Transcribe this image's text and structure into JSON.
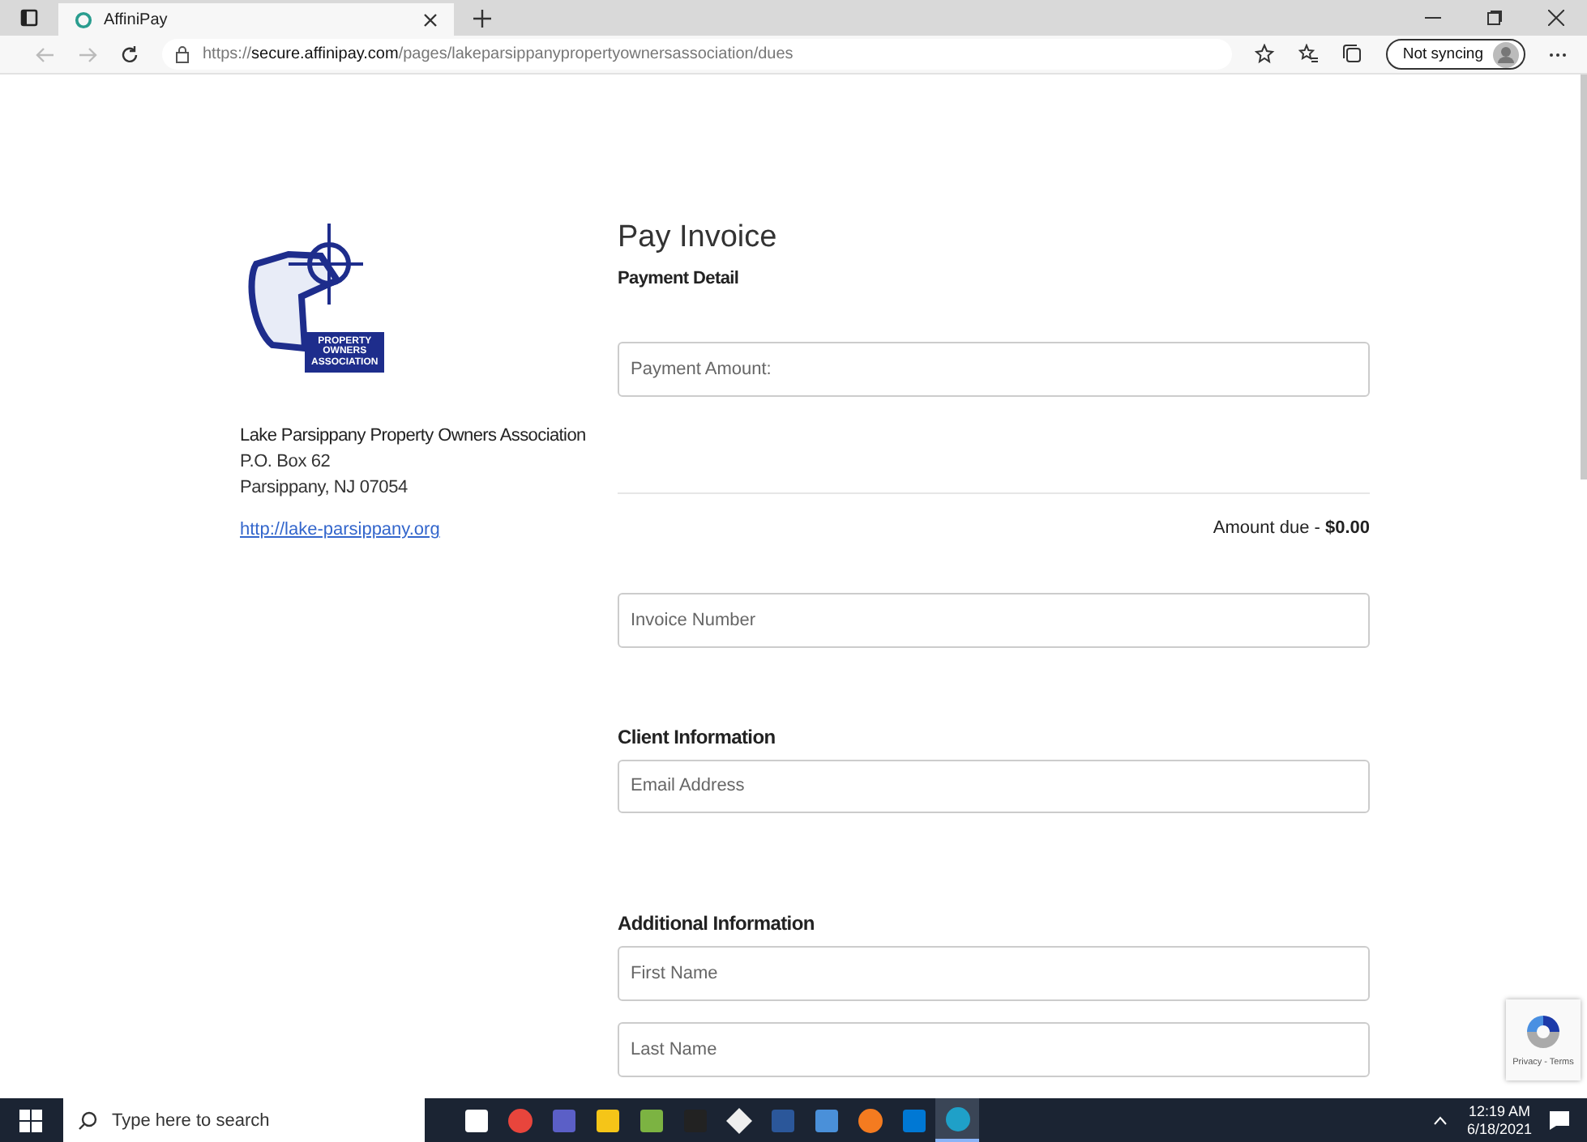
{
  "browser": {
    "tab": {
      "title": "AffiniPay"
    },
    "url": "https://**secure.affinipay.com**/pages/lakeparsippanypropertyownersassociation/dues",
    "sync": "Not syncing"
  },
  "org": {
    "logo_banner": [
      "PROPERTY",
      "OWNERS",
      "ASSOCIATION"
    ],
    "name": "Lake Parsippany Property Owners Association",
    "address": [
      "P.O. Box 62",
      "Parsippany, NJ 07054"
    ],
    "link": "http://lake-parsippany.org"
  },
  "form": {
    "title": "Pay Invoice",
    "subtitle": "Payment Detail",
    "amount_placeholder": "Payment Amount:",
    "amount_due_label": "Amount due - ",
    "amount_due_value": "$0.00",
    "invoice_placeholder": "Invoice Number",
    "sections": [
      {
        "title": "Client Information",
        "fields": [
          {
            "placeholder": "Email Address"
          }
        ]
      },
      {
        "title": "Additional Information",
        "fields": [
          {
            "placeholder": "First Name"
          },
          {
            "placeholder": "Last Name"
          }
        ]
      }
    ]
  },
  "recaptcha": {
    "label": "Privacy - Terms"
  },
  "taskbar": {
    "search_placeholder": "Type here to search",
    "apps": [
      {
        "kind": "taskview",
        "selected": false
      },
      {
        "kind": "chrome",
        "selected": false
      },
      {
        "kind": "teams",
        "selected": false
      },
      {
        "kind": "folder",
        "selected": false
      },
      {
        "kind": "notepad",
        "selected": false
      },
      {
        "kind": "terminal",
        "selected": false
      },
      {
        "kind": "diamond",
        "selected": false
      },
      {
        "kind": "word",
        "selected": false
      },
      {
        "kind": "computer",
        "selected": false
      },
      {
        "kind": "orange",
        "selected": false
      },
      {
        "kind": "outlook",
        "selected": false
      },
      {
        "kind": "edge",
        "selected": true
      }
    ],
    "time": "12:19 AM",
    "date": "6/18/2021"
  }
}
